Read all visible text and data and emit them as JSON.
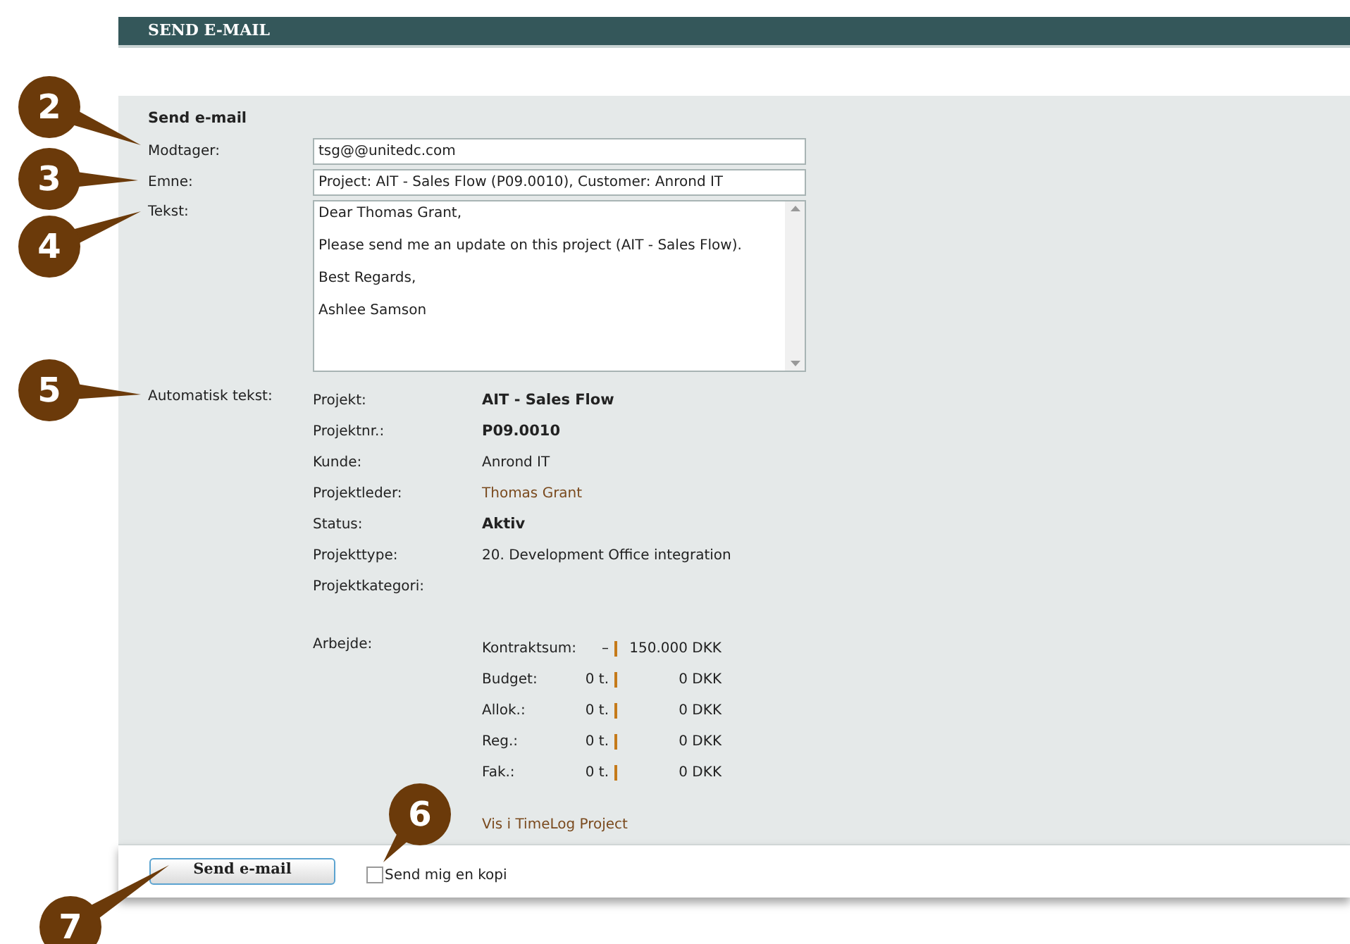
{
  "header": {
    "title": "SEND E-MAIL"
  },
  "form": {
    "heading": "Send e-mail",
    "recipient": {
      "label": "Modtager:",
      "value": "tsg@@unitedc.com"
    },
    "subject": {
      "label": "Emne:",
      "value": "Project: AIT - Sales Flow (P09.0010), Customer: Anrond IT"
    },
    "body": {
      "label": "Tekst:",
      "lines": [
        "Dear Thomas Grant,",
        "Please send me an update on this project (AIT - Sales Flow).",
        "Best Regards,",
        "Ashlee Samson"
      ]
    },
    "auto_text": {
      "label": "Automatisk tekst:",
      "rows": [
        {
          "label": "Projekt:",
          "value": "AIT - Sales Flow",
          "kind": "bold"
        },
        {
          "label": "Projektnr.:",
          "value": "P09.0010",
          "kind": "bold"
        },
        {
          "label": "Kunde:",
          "value": "Anrond IT",
          "kind": "plain"
        },
        {
          "label": "Projektleder:",
          "value": "Thomas Grant",
          "kind": "link"
        },
        {
          "label": "Status:",
          "value": "Aktiv",
          "kind": "bold"
        },
        {
          "label": "Projekttype:",
          "value": "20. Development Office integration",
          "kind": "plain"
        },
        {
          "label": "Projektkategori:"
        }
      ],
      "work": {
        "label": "Arbejde:",
        "rows": [
          {
            "label": "Kontraktsum:",
            "hours": "–",
            "amount": "150.000 DKK"
          },
          {
            "label": "Budget:",
            "hours": "0 t.",
            "amount": "0 DKK"
          },
          {
            "label": "Allok.:",
            "hours": "0 t.",
            "amount": "0 DKK"
          },
          {
            "label": "Reg.:",
            "hours": "0 t.",
            "amount": "0 DKK"
          },
          {
            "label": "Fak.:",
            "hours": "0 t.",
            "amount": "0 DKK"
          }
        ]
      },
      "link": "Vis i TimeLog Project"
    }
  },
  "footer": {
    "send_button": "Send e-mail",
    "copy_checkbox": {
      "label": "Send mig en kopi",
      "checked": false
    }
  },
  "callouts": [
    {
      "number": "2"
    },
    {
      "number": "3"
    },
    {
      "number": "4"
    },
    {
      "number": "5"
    },
    {
      "number": "6"
    },
    {
      "number": "7"
    }
  ]
}
